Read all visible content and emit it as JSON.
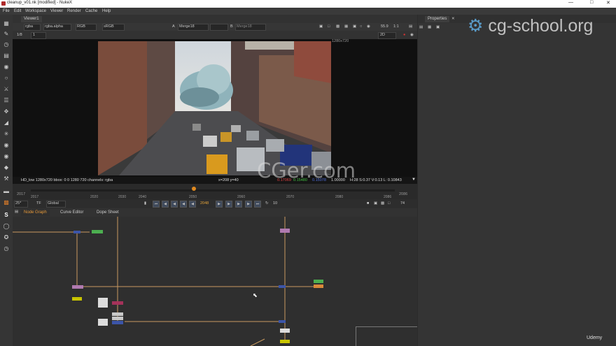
{
  "window": {
    "title": "cleanup_v01.nk [modified] - NukeX"
  },
  "menu": [
    "File",
    "Edit",
    "Workspace",
    "Viewer",
    "Render",
    "Cache",
    "Help"
  ],
  "viewer": {
    "tab_label": "Viewer1",
    "channels": "rgba",
    "alpha_channel": "rgba.alpha",
    "colorspace": "RGB",
    "lut": "sRGB",
    "input_a_label": "A",
    "input_a": "Merge18",
    "input_b_label": "B",
    "input_b": "Merge18",
    "frame_step": "1/8",
    "frame_field": "1",
    "zoom": "55.9",
    "proxy": "1:1",
    "view_mode": "2D",
    "format_label": "1280x720",
    "info_left": "HD_low 1280x720  bbox: 0 0 1280 720 channels: rgba",
    "info_coords": "x=208 y=40",
    "info_r": "0.17069",
    "info_g": "0.15480",
    "info_b": "0.15078",
    "info_a": "1.00000",
    "info_rest": "H:28 S:0.37 V:0.13  L: 0.10843"
  },
  "timeline": {
    "start": "2017",
    "end": "2086",
    "ticks": [
      "2017",
      "2020",
      "2030",
      "2040",
      "2050",
      "2060",
      "2070",
      "2080",
      "2086"
    ],
    "current_frame": "2048",
    "fps": "25*",
    "tf": "TF",
    "scope": "Global",
    "increment": "10",
    "end_frame": "74",
    "current_frame_pos": 0.449
  },
  "panels": {
    "node_graph": "Node Graph",
    "curve_editor": "Curve Editor",
    "dope_sheet": "Dope Sheet",
    "properties": "Properties"
  },
  "watermarks": {
    "cg_school": "cg-school.org",
    "cgerr": "CGer.com",
    "udemy": "Udemy"
  },
  "colors": {
    "node_green": "#4caf50",
    "node_purple": "#b07ab0",
    "node_blue": "#3c55a8",
    "node_yellow": "#c8c400",
    "node_orange": "#d98a3a",
    "node_maroon": "#a4325a",
    "line_orange": "#c89a60"
  }
}
